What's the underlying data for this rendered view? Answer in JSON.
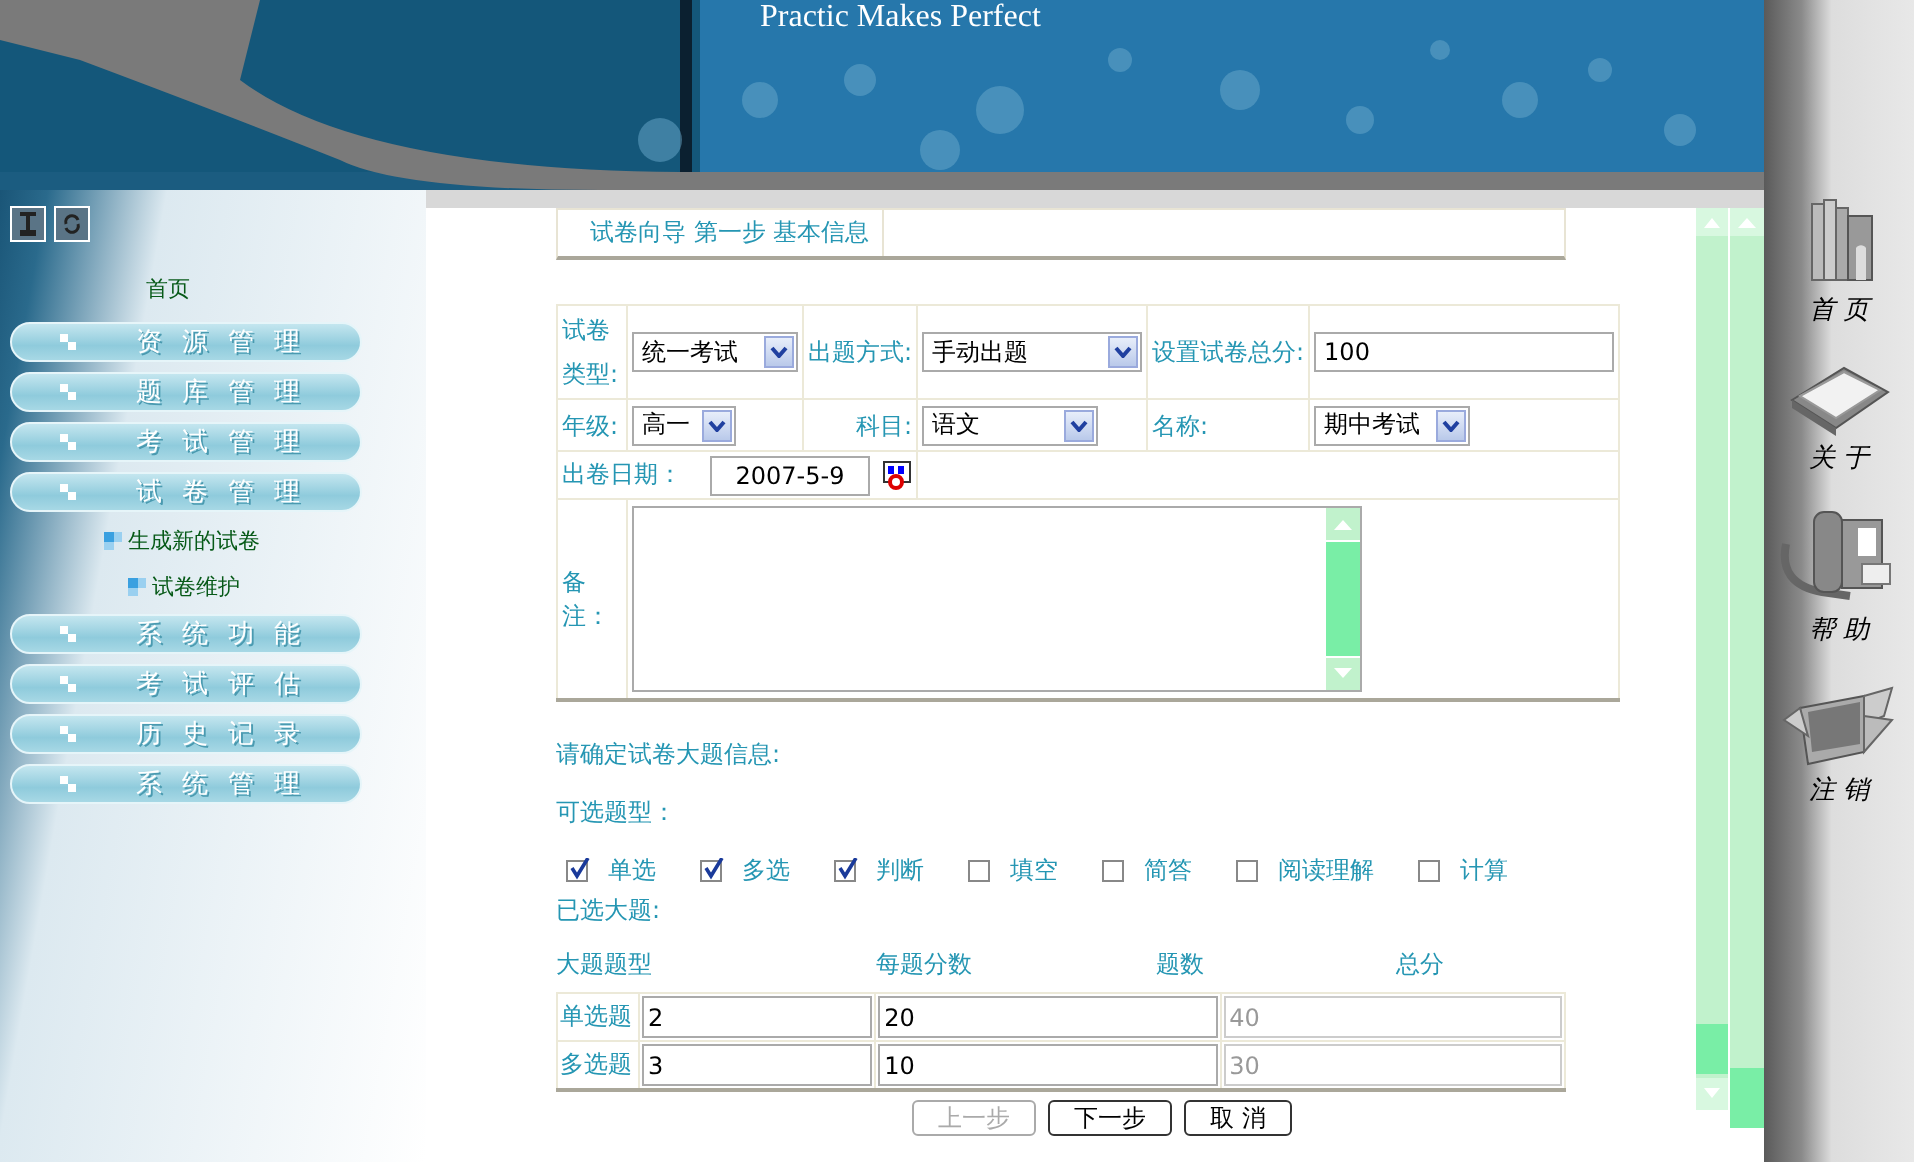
{
  "header": {
    "slogan": "Practic Makes Perfect"
  },
  "sidebar": {
    "home_link": "首页",
    "items": [
      {
        "label": "资源管理"
      },
      {
        "label": "题库管理"
      },
      {
        "label": "考试管理"
      },
      {
        "label": "试卷管理",
        "children": [
          {
            "label": "生成新的试卷"
          },
          {
            "label": "试卷维护"
          }
        ]
      },
      {
        "label": "系统功能"
      },
      {
        "label": "考试评估"
      },
      {
        "label": "历史记录"
      },
      {
        "label": "系统管理"
      }
    ]
  },
  "wizard": {
    "title": "试卷向导 第一步 基本信息"
  },
  "fields": [
    {
      "label": "试卷类型:",
      "kind": "select",
      "value": "统一考试"
    },
    {
      "label": "出题方式:",
      "kind": "select",
      "value": "手动出题"
    },
    {
      "label": "设置试卷总分:",
      "kind": "text",
      "value": "100"
    },
    {
      "label": "年级:",
      "kind": "select",
      "value": "高一"
    },
    {
      "label": "科目:",
      "kind": "select",
      "value": "语文"
    },
    {
      "label": "名称:",
      "kind": "select",
      "value": "期中考试"
    },
    {
      "label": "出卷日期：",
      "kind": "date",
      "value": "2007-5-9"
    }
  ],
  "remarks": {
    "label": "备注："
  },
  "prompt": "请确定试卷大题信息:",
  "types_label": "可选题型：",
  "question_types": [
    {
      "label": "单选",
      "checked": true
    },
    {
      "label": "多选",
      "checked": true
    },
    {
      "label": "判断",
      "checked": true
    },
    {
      "label": "填空",
      "checked": false
    },
    {
      "label": "简答",
      "checked": false
    },
    {
      "label": "阅读理解",
      "checked": false
    },
    {
      "label": "计算",
      "checked": false
    }
  ],
  "selected_label": "已选大题:",
  "table": {
    "columns": [
      "大题题型",
      "每题分数",
      "题数",
      "总分"
    ],
    "rows": [
      {
        "type": "单选题",
        "score": "2",
        "count": "20",
        "total": "40"
      },
      {
        "type": "多选题",
        "score": "3",
        "count": "10",
        "total": "30"
      }
    ]
  },
  "buttons": [
    {
      "label": "上一步",
      "disabled": true
    },
    {
      "label": "下一步",
      "disabled": false
    },
    {
      "label": "取 消",
      "disabled": false
    }
  ],
  "dock": [
    {
      "label": "首 页",
      "kind": "books"
    },
    {
      "label": "关 于",
      "kind": "folder"
    },
    {
      "label": "帮 助",
      "kind": "phone"
    },
    {
      "label": "注 销",
      "kind": "box"
    }
  ]
}
